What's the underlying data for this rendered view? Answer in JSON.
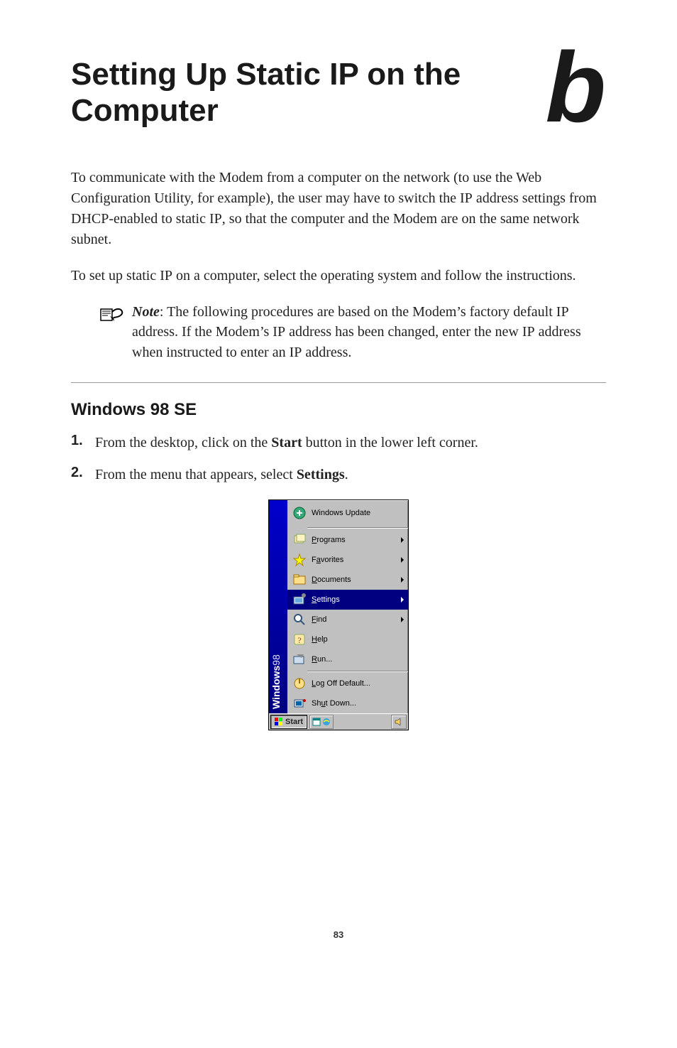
{
  "title": "Setting Up Static IP on the Computer",
  "chapter_letter": "b",
  "paragraphs": {
    "p1_a": "To communicate with the Modem from a computer on the network (to use the Web Configuration Utility, for example), the user may have to switch the ",
    "p1_b": " address settings from ",
    "p1_c": "-enabled to static ",
    "p1_d": ", so that the computer and the Modem are on the same network subnet.",
    "p2_a": "To set up static ",
    "p2_b": " on a computer, select the operating system and follow the instructions.",
    "ip": "IP",
    "dhcp": "DHCP"
  },
  "note": {
    "lead": "Note",
    "a": ": The following procedures are based on the Modem’s factory default ",
    "b": " address. If the Modem’s ",
    "c": " address has been changed, enter the new ",
    "d": " address when instructed to enter an ",
    "e": " address.",
    "ip": "IP"
  },
  "section_heading": "Windows 98 SE",
  "steps": {
    "n1": "1.",
    "s1_a": "From the desktop, click on the ",
    "s1_b": "Start",
    "s1_c": " button in the lower left corner.",
    "n2": "2.",
    "s2_a": "From the menu that appears, select ",
    "s2_b": "Settings",
    "s2_c": "."
  },
  "start_menu": {
    "brand": "Windows",
    "ver": "98",
    "items": [
      {
        "label": "Windows Update",
        "hotkey_index": -1,
        "tall": true
      },
      {
        "sep": true
      },
      {
        "label": "Programs",
        "hotkey_index": 0,
        "arrow": true
      },
      {
        "label": "Favorites",
        "hotkey_index": 1,
        "arrow": true
      },
      {
        "label": "Documents",
        "hotkey_index": 0,
        "arrow": true
      },
      {
        "label": "Settings",
        "hotkey_index": 0,
        "arrow": true,
        "selected": true
      },
      {
        "label": "Find",
        "hotkey_index": 0,
        "arrow": true
      },
      {
        "label": "Help",
        "hotkey_index": 0
      },
      {
        "label": "Run...",
        "hotkey_index": 0
      },
      {
        "sep": true
      },
      {
        "label": "Log Off Default...",
        "hotkey_index": 0
      },
      {
        "label": "Shut Down...",
        "hotkey_index": 2
      }
    ],
    "start_button": "Start"
  },
  "page_number": "83"
}
